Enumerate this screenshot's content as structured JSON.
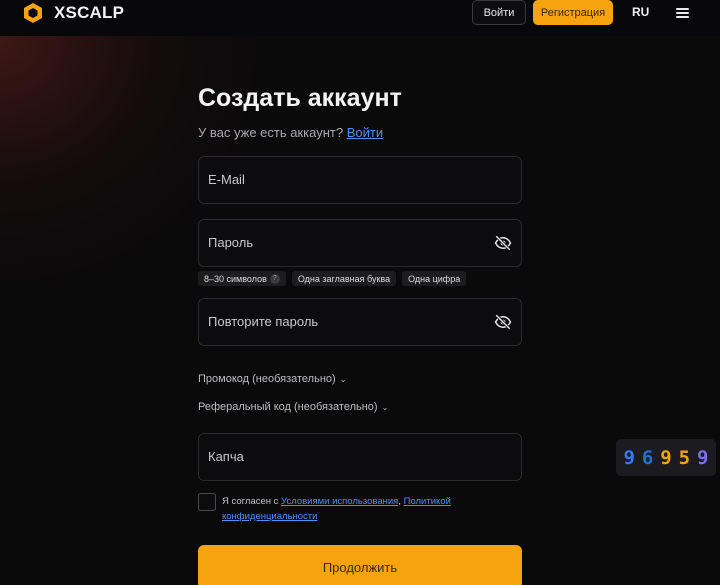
{
  "header": {
    "brand": "XSCALP",
    "login_label": "Войти",
    "register_label": "Регистрация",
    "lang": "RU"
  },
  "form": {
    "title": "Создать аккаунт",
    "have_account": "У вас уже есть аккаунт?",
    "login_link": "Войти",
    "email_placeholder": "E-Mail",
    "password_placeholder": "Пароль",
    "repeat_password_placeholder": "Повторите пароль",
    "hints": [
      "8–30 символов",
      "Одна заглавная буква",
      "Одна цифра"
    ],
    "promo_label": "Промокод (необязательно)",
    "referral_label": "Реферальный код (необязательно)",
    "captcha_placeholder": "Капча",
    "captcha_digits": [
      "9",
      "6",
      "9",
      "5",
      "9"
    ],
    "agree_prefix": "Я согласен с",
    "terms_link": "Условиями использования",
    "privacy_link": "Политикой конфиденциальности",
    "continue_label": "Продолжить"
  },
  "colors": {
    "accent": "#f5a30f",
    "link": "#4f8ef7",
    "captcha_digits": [
      "#2f7df0",
      "#1f6fd8",
      "#f5a30f",
      "#f5a30f",
      "#7a6df5"
    ]
  }
}
